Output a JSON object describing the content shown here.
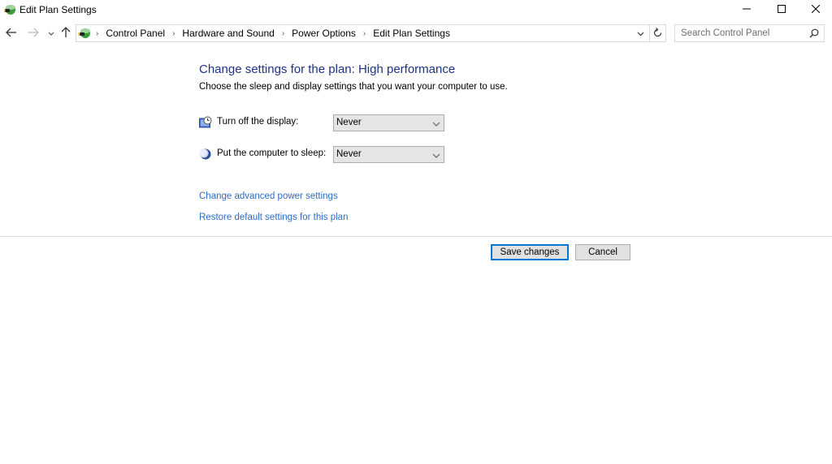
{
  "window": {
    "title": "Edit Plan Settings",
    "app_icon": "control-panel-power-icon",
    "controls": {
      "minimize": "minimize-icon",
      "maximize": "maximize-icon",
      "close": "close-icon"
    }
  },
  "navigation": {
    "back": "back-arrow-icon",
    "forward": "forward-arrow-icon",
    "recent": "chevron-down-icon",
    "up": "up-arrow-icon",
    "breadcrumb": [
      {
        "label": "Control Panel"
      },
      {
        "label": "Hardware and Sound"
      },
      {
        "label": "Power Options"
      },
      {
        "label": "Edit Plan Settings"
      }
    ],
    "separator": "›",
    "refresh": "refresh-icon"
  },
  "search": {
    "placeholder": "Search Control Panel",
    "value": ""
  },
  "main": {
    "heading": "Change settings for the plan: High performance",
    "subtitle": "Choose the sleep and display settings that you want your computer to use.",
    "settings": [
      {
        "label": "Turn off the display:",
        "value": "Never",
        "icon": "display-icon"
      },
      {
        "label": "Put the computer to sleep:",
        "value": "Never",
        "icon": "sleep-moon-icon"
      }
    ],
    "links": [
      {
        "label": "Change advanced power settings"
      },
      {
        "label": "Restore default settings for this plan"
      }
    ]
  },
  "buttons": {
    "save": "Save changes",
    "cancel": "Cancel"
  },
  "colors": {
    "heading": "#1e3287",
    "link": "#2e6cc4",
    "default_button_border": "#0078d7"
  }
}
